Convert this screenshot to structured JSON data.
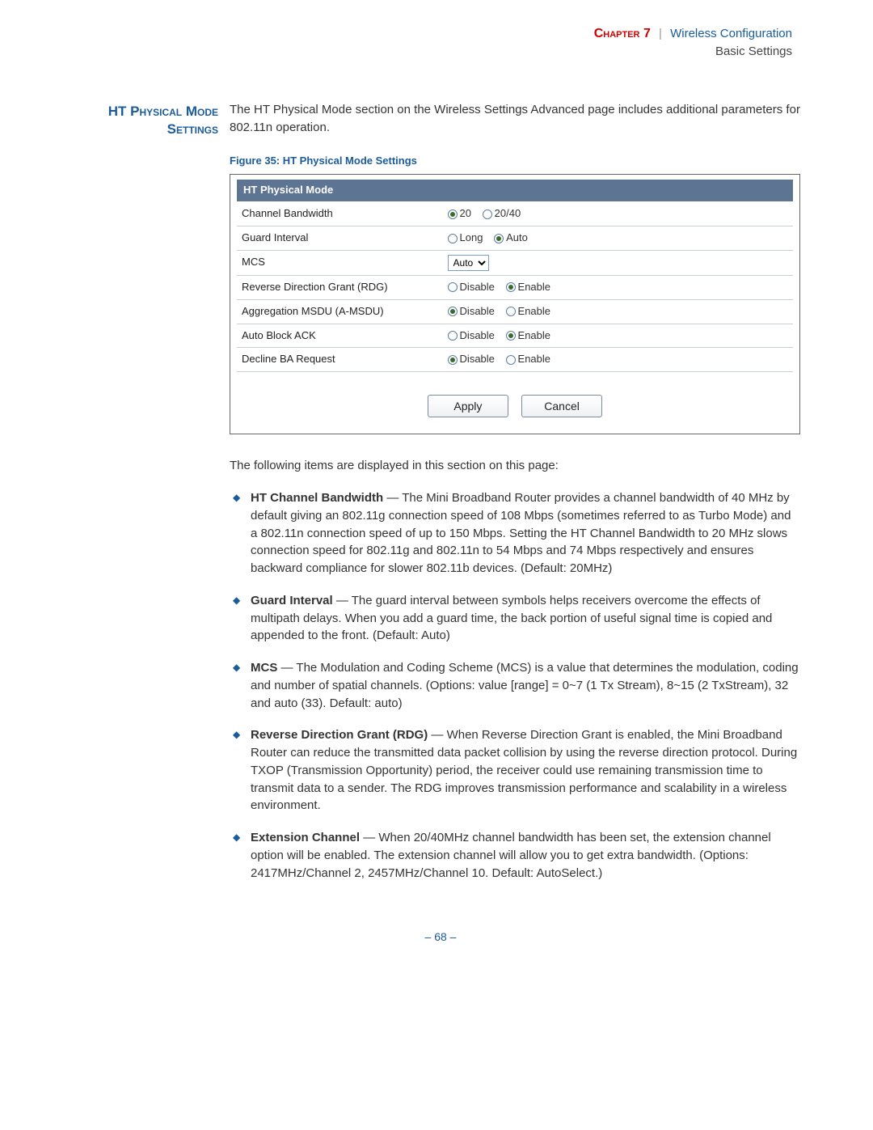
{
  "header": {
    "chapter": "Chapter 7",
    "separator": "|",
    "title": "Wireless Configuration",
    "subtitle": "Basic Settings"
  },
  "sideHeading": "HT Physical Mode Settings",
  "intro": "The HT Physical Mode section on the Wireless Settings Advanced page includes additional parameters for 802.11n operation.",
  "figure": {
    "caption": "Figure 35:  HT Physical Mode Settings",
    "panelTitle": "HT Physical Mode",
    "rows": {
      "channelBandwidth": {
        "label": "Channel Bandwidth",
        "opt1": "20",
        "opt2": "20/40",
        "selected": "20"
      },
      "guardInterval": {
        "label": "Guard Interval",
        "opt1": "Long",
        "opt2": "Auto",
        "selected": "Auto"
      },
      "mcs": {
        "label": "MCS",
        "value": "Auto"
      },
      "rdg": {
        "label": "Reverse Direction Grant (RDG)",
        "opt1": "Disable",
        "opt2": "Enable",
        "selected": "Enable"
      },
      "amsdu": {
        "label": "Aggregation MSDU (A-MSDU)",
        "opt1": "Disable",
        "opt2": "Enable",
        "selected": "Disable"
      },
      "autoBlockAck": {
        "label": "Auto Block ACK",
        "opt1": "Disable",
        "opt2": "Enable",
        "selected": "Enable"
      },
      "declineBa": {
        "label": "Decline BA Request",
        "opt1": "Disable",
        "opt2": "Enable",
        "selected": "Disable"
      }
    },
    "buttons": {
      "apply": "Apply",
      "cancel": "Cancel"
    }
  },
  "lead": "The following items are displayed in this section on this page:",
  "items": [
    {
      "title": "HT Channel Bandwidth",
      "text": " — The Mini Broadband Router provides a channel bandwidth of 40 MHz by default giving an 802.11g connection speed of 108 Mbps (sometimes referred to as Turbo Mode) and a 802.11n connection speed of up to 150 Mbps. Setting the HT Channel Bandwidth to 20 MHz slows connection speed for 802.11g and 802.11n to 54 Mbps and 74 Mbps respectively and ensures backward compliance for slower 802.11b devices. (Default: 20MHz)"
    },
    {
      "title": "Guard Interval",
      "text": " — The guard interval between symbols helps receivers overcome the effects of multipath delays. When you add a guard time, the back portion of useful signal time is copied and appended to the front. (Default: Auto)"
    },
    {
      "title": "MCS",
      "text": " — The Modulation and Coding Scheme (MCS) is a value that determines the modulation, coding and number of spatial channels. (Options: value [range] = 0~7 (1 Tx Stream), 8~15 (2 TxStream), 32 and auto (33). Default: auto)"
    },
    {
      "title": "Reverse Direction Grant (RDG)",
      "text": " — When Reverse Direction Grant is enabled, the Mini Broadband Router can reduce the transmitted data packet collision by using the reverse direction protocol. During TXOP (Transmission Opportunity) period, the receiver could use remaining transmission time to transmit data to a sender. The RDG improves transmission performance and scalability in a wireless environment."
    },
    {
      "title": "Extension Channel",
      "text": " — When 20/40MHz channel bandwidth has been set, the extension channel option will be enabled. The extension channel will allow you to get extra bandwidth. (Options: 2417MHz/Channel 2, 2457MHz/Channel 10. Default: AutoSelect.)"
    }
  ],
  "pageNumber": "–  68  –"
}
